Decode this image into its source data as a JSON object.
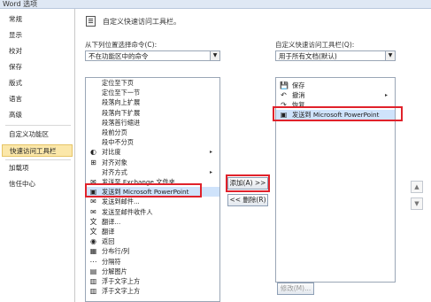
{
  "window": {
    "title": "Word 选项"
  },
  "sidebar": {
    "items": [
      {
        "label": "常规"
      },
      {
        "label": "显示"
      },
      {
        "label": "校对"
      },
      {
        "label": "保存"
      },
      {
        "label": "版式"
      },
      {
        "label": "语言"
      },
      {
        "label": "高级"
      },
      {
        "label": "自定义功能区"
      },
      {
        "label": "快速访问工具栏"
      },
      {
        "label": "加载项"
      },
      {
        "label": "信任中心"
      }
    ]
  },
  "main": {
    "header": "自定义快速访问工具栏。",
    "left_label": "从下列位置选择命令(C):",
    "left_select": "不在功能区中的命令",
    "right_label": "自定义快速访问工具栏(Q):",
    "right_select": "用于所有文档(默认)",
    "add_button": "添加(A) >>",
    "remove_button": "<< 删除(R)",
    "modify_button": "修改(M)..."
  },
  "command_list": [
    {
      "label": "定位至下页",
      "icon": ""
    },
    {
      "label": "定位至下一节",
      "icon": ""
    },
    {
      "label": "段落向上扩展",
      "icon": ""
    },
    {
      "label": "段落向下扩展",
      "icon": ""
    },
    {
      "label": "段落首行缩进",
      "icon": ""
    },
    {
      "label": "段前分页",
      "icon": ""
    },
    {
      "label": "段中不分页",
      "icon": ""
    },
    {
      "label": "对比度",
      "icon": "◐",
      "submenu": "▸"
    },
    {
      "label": "对齐对象",
      "icon": "⊞"
    },
    {
      "label": "对齐方式",
      "icon": "",
      "submenu": "▸"
    },
    {
      "label": "发送至 Exchange 文件夹",
      "icon": "✉"
    },
    {
      "label": "发送到 Microsoft PowerPoint",
      "icon": "▣"
    },
    {
      "label": "发送到邮件...",
      "icon": "✉"
    },
    {
      "label": "发送至邮件收件人",
      "icon": "✉"
    },
    {
      "label": "翻译...",
      "icon": "文"
    },
    {
      "label": "翻译",
      "icon": "文"
    },
    {
      "label": "返回",
      "icon": "◉"
    },
    {
      "label": "分布行/列",
      "icon": "▦"
    },
    {
      "label": "分隔符",
      "icon": "⋯"
    },
    {
      "label": "分解图片",
      "icon": "▤"
    },
    {
      "label": "浮于文字上方",
      "icon": "▥"
    },
    {
      "label": "浮于文字上方",
      "icon": "▥"
    }
  ],
  "toolbar_list": [
    {
      "label": "保存",
      "icon": "💾"
    },
    {
      "label": "撤消",
      "icon": "↶",
      "submenu": "▸"
    },
    {
      "label": "恢复",
      "icon": "↷"
    },
    {
      "label": "发送到 Microsoft PowerPoint",
      "icon": "▣"
    }
  ],
  "colors": {
    "highlight": "#e0222b",
    "selected_bg": "#fbe7a9",
    "list_select": "#cfe3fb"
  }
}
